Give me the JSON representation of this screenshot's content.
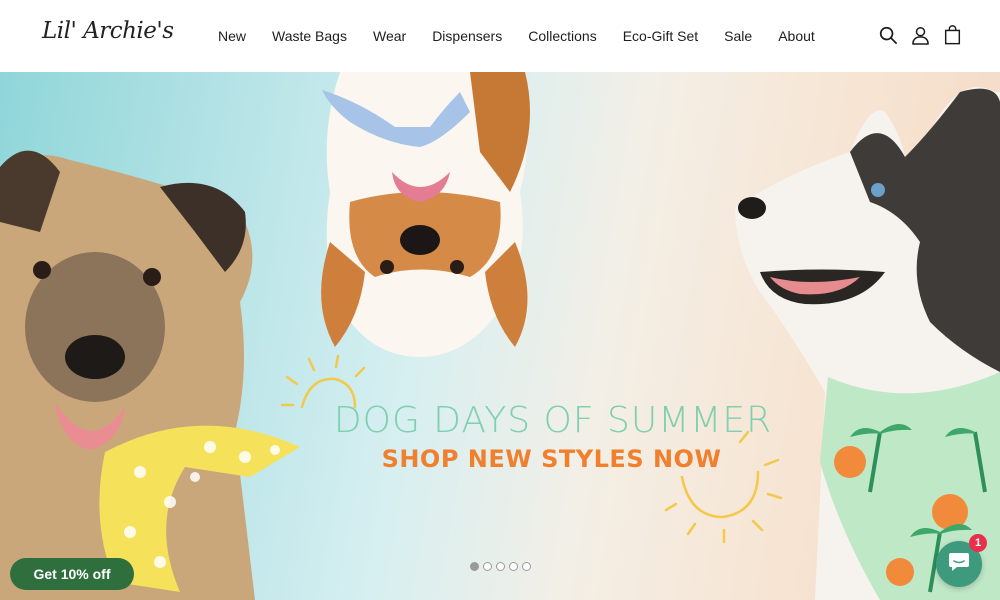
{
  "brand": {
    "logo_text": "Lil' Archie's"
  },
  "nav": {
    "items": [
      {
        "label": "New"
      },
      {
        "label": "Waste Bags"
      },
      {
        "label": "Wear"
      },
      {
        "label": "Dispensers"
      },
      {
        "label": "Collections"
      },
      {
        "label": "Eco-Gift Set"
      },
      {
        "label": "Sale"
      },
      {
        "label": "About"
      }
    ]
  },
  "header_icons": [
    "search-icon",
    "account-icon",
    "cart-icon"
  ],
  "hero": {
    "headline": "DOG DAYS OF SUMMER",
    "subline": "SHOP NEW STYLES NOW",
    "slide_count": 5,
    "active_slide": 1,
    "colors": {
      "headline": "#7fcfb1",
      "subline": "#f07f2e",
      "sun": "#f2c94c"
    }
  },
  "promo": {
    "label": "Get 10% off",
    "color": "#2f6f3d"
  },
  "chat": {
    "badge_count": "1",
    "icon": "chat-icon",
    "color": "#3e9a7c"
  }
}
